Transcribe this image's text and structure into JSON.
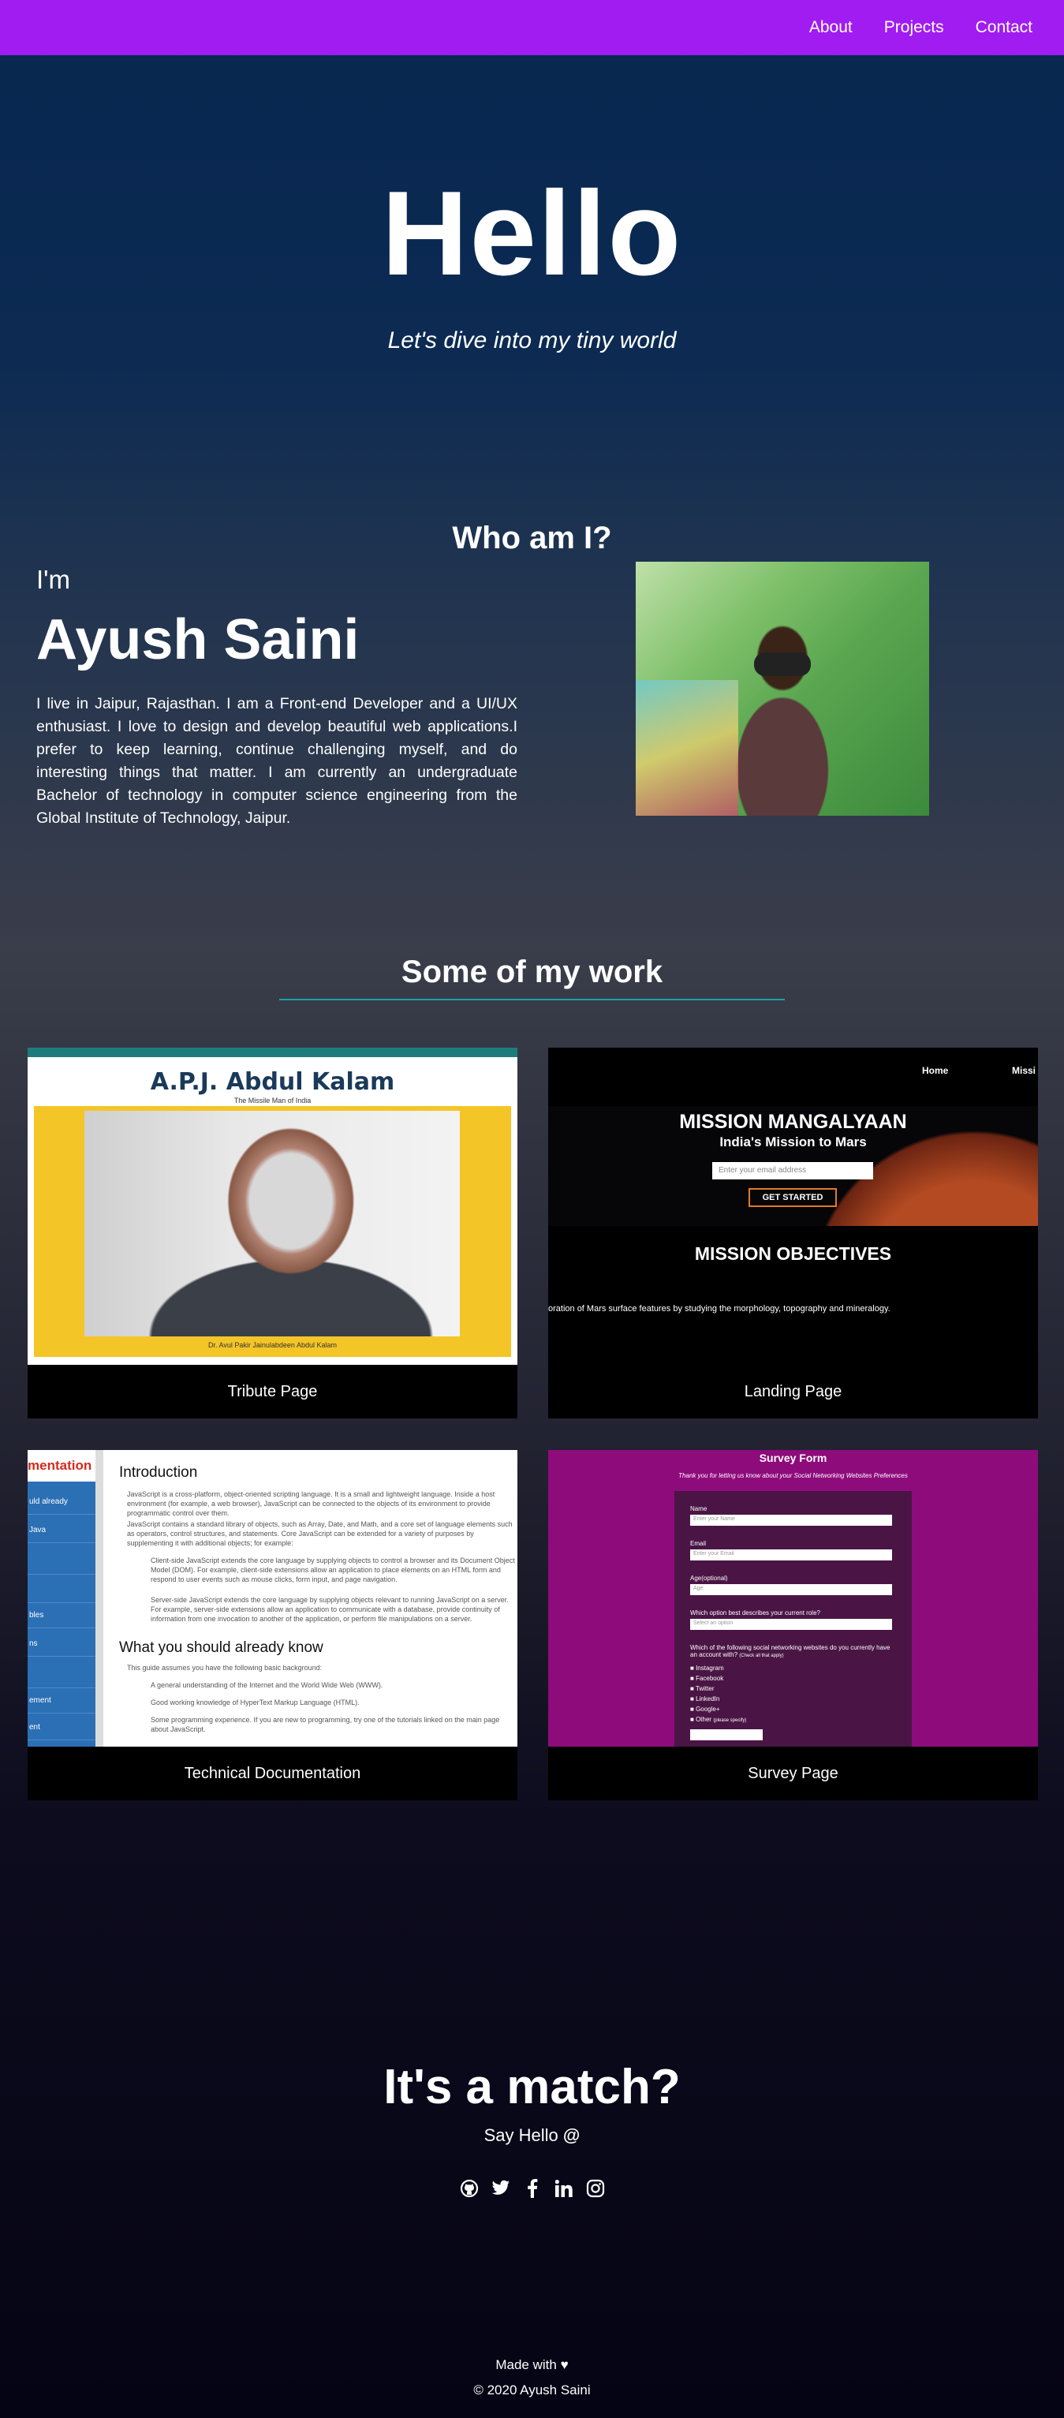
{
  "nav": {
    "about": "About",
    "projects": "Projects",
    "contact": "Contact"
  },
  "hero": {
    "title": "Hello",
    "subtitle": "Let's dive into my tiny world"
  },
  "about": {
    "title": "Who am I?",
    "intro": "I'm",
    "name": "Ayush Saini",
    "bio": "I live in Jaipur, Rajasthan. I am a Front-end Developer and a UI/UX enthusiast. I love to design and develop beautiful web applications.I prefer to keep learning, continue challenging myself, and do interesting things that matter. I am currently an undergraduate Bachelor of technology in computer science engineering from the Global Institute of Technology, Jaipur."
  },
  "work": {
    "title": "Some of my work",
    "projects": [
      {
        "label": "Tribute Page"
      },
      {
        "label": "Landing Page"
      },
      {
        "label": "Technical Documentation"
      },
      {
        "label": "Survey Page"
      }
    ]
  },
  "tribute_mock": {
    "title": "A.P.J. Abdul Kalam",
    "motto": "The Missile Man of India",
    "caption": "Dr. Avul Pakir Jainulabdeen Abdul Kalam"
  },
  "landing_mock": {
    "nav_home": "Home",
    "nav_mission": "Missi",
    "heading": "MISSION MANGALYAAN",
    "subheading": "India's Mission to Mars",
    "email_placeholder": "Enter your email address",
    "cta": "GET STARTED",
    "objectives": "MISSION OBJECTIVES",
    "objective_text": "oration of Mars surface features by studying the morphology, topography and mineralogy."
  },
  "docs_mock": {
    "sidebar_title": "mentation",
    "sidebar_items": [
      "uld already",
      "Java",
      "",
      "",
      "bles",
      "ns",
      "",
      "",
      "ement",
      "ent"
    ],
    "intro_heading": "Introduction",
    "intro_p1": "JavaScript is a cross-platform, object-oriented scripting language. It is a small and lightweight language. Inside a host environment (for example, a web browser), JavaScript can be connected to the objects of its environment to provide programmatic control over them.",
    "intro_p2": "JavaScript contains a standard library of objects, such as Array, Date, and Math, and a core set of language elements such as operators, control structures, and statements. Core JavaScript can be extended for a variety of purposes by supplementing it with additional objects; for example:",
    "li1": "Client-side JavaScript extends the core language by supplying objects to control a browser and its Document Object Model (DOM). For example, client-side extensions allow an application to place elements on an HTML form and respond to user events such as mouse clicks, form input, and page navigation.",
    "li2": "Server-side JavaScript extends the core language by supplying objects relevant to running JavaScript on a server. For example, server-side extensions allow an application to communicate with a database, provide continuity of information from one invocation to another of the application, or perform file manipulations on a server.",
    "know_heading": "What you should already know",
    "know_p": "This guide assumes you have the following basic background:",
    "know1": "A general understanding of the Internet and the World Wide Web (WWW).",
    "know2": "Good working knowledge of HyperText Markup Language (HTML).",
    "know3": "Some programming experience. If you are new to programming, try one of the tutorials linked on the main page about JavaScript."
  },
  "survey_mock": {
    "title": "Survey Form",
    "subtitle": "Thank you for letting us know about your Social Networking Websites Preferences",
    "name_label": "Name",
    "name_placeholder": "Enter your Name",
    "email_label": "Email",
    "email_placeholder": "Enter your Email",
    "age_label": "Age(optional)",
    "age_placeholder": "Age",
    "role_label": "Which option best describes your current role?",
    "role_placeholder": "Select an option",
    "sites_label": "Which of the following social networking websites do you currently have an account with?",
    "sites_hint": "(Check all that apply)",
    "sites": [
      "Instagram",
      "Facebook",
      "Twitter",
      "LinkedIn",
      "Google+",
      "Other"
    ],
    "other_hint": "(please specify)"
  },
  "contact": {
    "title": "It's a match?",
    "say_hello": "Say Hello",
    "at_symbol": "@",
    "socials": [
      "github-icon",
      "twitter-icon",
      "facebook-icon",
      "linkedin-icon",
      "instagram-icon"
    ]
  },
  "footer": {
    "made_with": "Made with",
    "heart": "♥",
    "copyright": "© 2020 Ayush Saini"
  },
  "colors": {
    "navbar": "#a01cf0",
    "accent_line": "#1ba0a8"
  }
}
